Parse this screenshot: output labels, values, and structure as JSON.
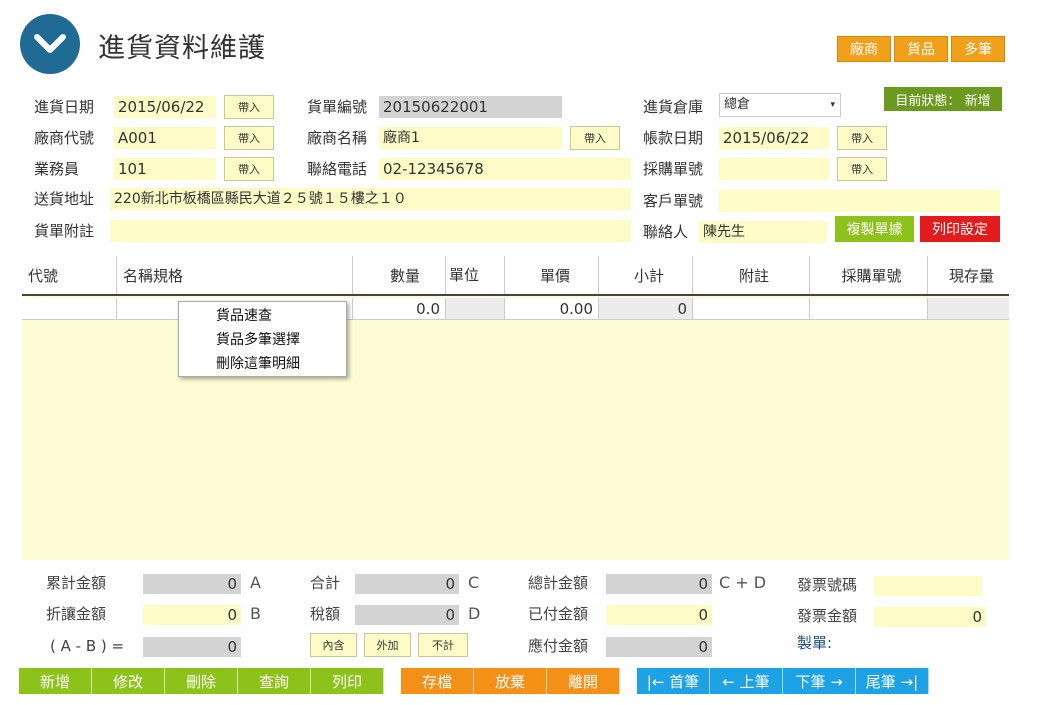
{
  "title": "進貨資料維護",
  "top_buttons": {
    "vendor": "廠商",
    "goods": "貨品",
    "multi": "多筆"
  },
  "status": {
    "label": "目前狀態：",
    "value": "新增"
  },
  "form": {
    "purchase_date": {
      "label": "進貨日期",
      "value": "2015/06/22"
    },
    "order_no": {
      "label": "貨單編號",
      "value": "20150622001"
    },
    "warehouse": {
      "label": "進貨倉庫",
      "value": "總倉"
    },
    "vendor_code": {
      "label": "廠商代號",
      "value": "A001"
    },
    "vendor_name": {
      "label": "廠商名稱",
      "value": "廠商1"
    },
    "account_date": {
      "label": "帳款日期",
      "value": "2015/06/22"
    },
    "salesperson": {
      "label": "業務員",
      "value": "101"
    },
    "phone": {
      "label": "聯絡電話",
      "value": "02-12345678"
    },
    "po_no": {
      "label": "採購單號",
      "value": ""
    },
    "address": {
      "label": "送貨地址",
      "value": "220新北市板橋區縣民大道２５號１５樓之１０"
    },
    "customer_no": {
      "label": "客戶單號",
      "value": ""
    },
    "note": {
      "label": "貨單附註",
      "value": ""
    },
    "contact": {
      "label": "聯絡人",
      "value": "陳先生"
    },
    "import_label": "帶入"
  },
  "action_buttons": {
    "copy": "複製單據",
    "print_setting": "列印設定"
  },
  "grid": {
    "headers": [
      "代號",
      "名稱規格",
      "數量",
      "單位",
      "單價",
      "小計",
      "附註",
      "採購單號",
      "現存量"
    ],
    "row": {
      "qty": "0.0",
      "price": "0.00",
      "subtotal": "0"
    }
  },
  "context_menu": [
    "貨品速查",
    "貨品多筆選擇",
    "刪除這筆明細"
  ],
  "summary": {
    "cumulative": {
      "label": "累計金額",
      "value": "0",
      "tag": "A"
    },
    "discount": {
      "label": "折讓金額",
      "value": "0",
      "tag": "B"
    },
    "net": {
      "label": "( A - B ) =",
      "value": "0"
    },
    "total": {
      "label": "合計",
      "value": "0",
      "tag": "C"
    },
    "tax": {
      "label": "稅額",
      "value": "0",
      "tag": "D"
    },
    "grand": {
      "label": "總計金額",
      "value": "0",
      "tag": "C + D"
    },
    "paid": {
      "label": "已付金額",
      "value": "0"
    },
    "payable": {
      "label": "應付金額",
      "value": "0"
    },
    "invoice_no": {
      "label": "發票號碼",
      "value": ""
    },
    "invoice_amount": {
      "label": "發票金額",
      "value": "0"
    },
    "maker": {
      "label": "製單:"
    },
    "tax_buttons": [
      "內含",
      "外加",
      "不計"
    ]
  },
  "bottom": {
    "green": [
      "新增",
      "修改",
      "刪除",
      "查詢",
      "列印"
    ],
    "orange": [
      "存檔",
      "放棄",
      "離開"
    ],
    "blue": [
      "|← 首筆",
      "← 上筆",
      "下筆 →",
      "尾筆 →|"
    ]
  }
}
